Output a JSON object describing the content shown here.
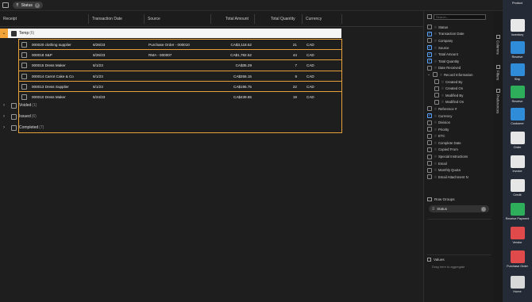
{
  "topbar": {
    "grouping_chip": "Status"
  },
  "grid": {
    "columns": [
      "Receipt",
      "Transaction Date",
      "Source",
      "Total Amount",
      "Total Quantity",
      "Currency"
    ],
    "groups": [
      {
        "label": "Temp",
        "count": "(6)"
      },
      {
        "label": "Voided",
        "count": "(1)"
      },
      {
        "label": "Issued",
        "count": "(6)"
      },
      {
        "label": "Completed",
        "count": "(7)"
      }
    ],
    "rows": [
      {
        "receipt": "000020 clothing supplier",
        "date": "6/26/23",
        "source": "Purchase Order - 000010",
        "amount": "CA$3,118.52",
        "qty": "21",
        "currency": "CAD"
      },
      {
        "receipt": "000018 S&P",
        "date": "6/26/23",
        "source": "RMA - 000007",
        "amount": "CA$1,782.52",
        "qty": "44",
        "currency": "CAD"
      },
      {
        "receipt": "000015 Dress Maker",
        "date": "6/1/23",
        "source": "",
        "amount": "CA$35.29",
        "qty": "7",
        "currency": "CAD"
      },
      {
        "receipt": "000014 Carrot Cake & Co",
        "date": "6/1/23",
        "source": "",
        "amount": "CA$255.15",
        "qty": "9",
        "currency": "CAD"
      },
      {
        "receipt": "000013 Dress Supplier",
        "date": "6/1/23",
        "source": "",
        "amount": "CA$195.75",
        "qty": "22",
        "currency": "CAD"
      },
      {
        "receipt": "000010 Dress Maker",
        "date": "5/24/23",
        "source": "",
        "amount": "CA$439.65",
        "qty": "19",
        "currency": "CAD"
      }
    ]
  },
  "panel": {
    "search_placeholder": "Search...",
    "columns": [
      {
        "label": "Status",
        "checked": false,
        "indent": false,
        "expander": ""
      },
      {
        "label": "Transaction Date",
        "checked": true,
        "indent": false,
        "expander": ""
      },
      {
        "label": "Company",
        "checked": false,
        "indent": false,
        "expander": ""
      },
      {
        "label": "Source",
        "checked": true,
        "indent": false,
        "expander": ""
      },
      {
        "label": "Total Amount",
        "checked": true,
        "indent": false,
        "expander": ""
      },
      {
        "label": "Total Quantity",
        "checked": true,
        "indent": false,
        "expander": ""
      },
      {
        "label": "Date Received",
        "checked": false,
        "indent": false,
        "expander": ""
      },
      {
        "label": "Record Information",
        "checked": false,
        "indent": false,
        "expander": "⌄"
      },
      {
        "label": "Created By",
        "checked": false,
        "indent": true,
        "expander": ""
      },
      {
        "label": "Created On",
        "checked": false,
        "indent": true,
        "expander": ""
      },
      {
        "label": "Modified By",
        "checked": false,
        "indent": true,
        "expander": ""
      },
      {
        "label": "Modified On",
        "checked": false,
        "indent": true,
        "expander": ""
      },
      {
        "label": "Reference #",
        "checked": false,
        "indent": false,
        "expander": ""
      },
      {
        "label": "Currency",
        "checked": true,
        "indent": false,
        "expander": ""
      },
      {
        "label": "Division",
        "checked": false,
        "indent": false,
        "expander": ""
      },
      {
        "label": "Priority",
        "checked": false,
        "indent": false,
        "expander": ""
      },
      {
        "label": "ETC",
        "checked": false,
        "indent": false,
        "expander": ""
      },
      {
        "label": "Complete Date",
        "checked": false,
        "indent": false,
        "expander": ""
      },
      {
        "label": "Copied From",
        "checked": false,
        "indent": false,
        "expander": ""
      },
      {
        "label": "Special Instructions",
        "checked": false,
        "indent": false,
        "expander": ""
      },
      {
        "label": "Email",
        "checked": false,
        "indent": false,
        "expander": ""
      },
      {
        "label": "Monthly Quota",
        "checked": false,
        "indent": false,
        "expander": ""
      },
      {
        "label": "Email Attachment N",
        "checked": false,
        "indent": false,
        "expander": ""
      }
    ],
    "row_groups_title": "Row Groups",
    "row_group_chip": "Status",
    "values_title": "Values",
    "values_hint": "Drag here to aggregate"
  },
  "vtabs": [
    "Columns",
    "Filters",
    "Preferences"
  ],
  "rail": [
    {
      "label": "Product",
      "color": "#f2f2f2"
    },
    {
      "label": "Inventory",
      "color": "#e8e8e8"
    },
    {
      "label": "Receive",
      "color": "#2f8cd8"
    },
    {
      "label": "Ship",
      "color": "#2f8cd8"
    },
    {
      "label": "Receive",
      "color": "#2eae5a"
    },
    {
      "label": "Customer",
      "color": "#2f8cd8"
    },
    {
      "label": "Order",
      "color": "#e6e6e6"
    },
    {
      "label": "Invoice",
      "color": "#e6e6e6"
    },
    {
      "label": "Credit",
      "color": "#e6e6e6"
    },
    {
      "label": "Receive Payment",
      "color": "#2eae5a"
    },
    {
      "label": "Vendor",
      "color": "#e04a4a"
    },
    {
      "label": "Purchase Order",
      "color": "#e04a4a"
    },
    {
      "label": "Home",
      "color": "#d8d8d8"
    }
  ]
}
